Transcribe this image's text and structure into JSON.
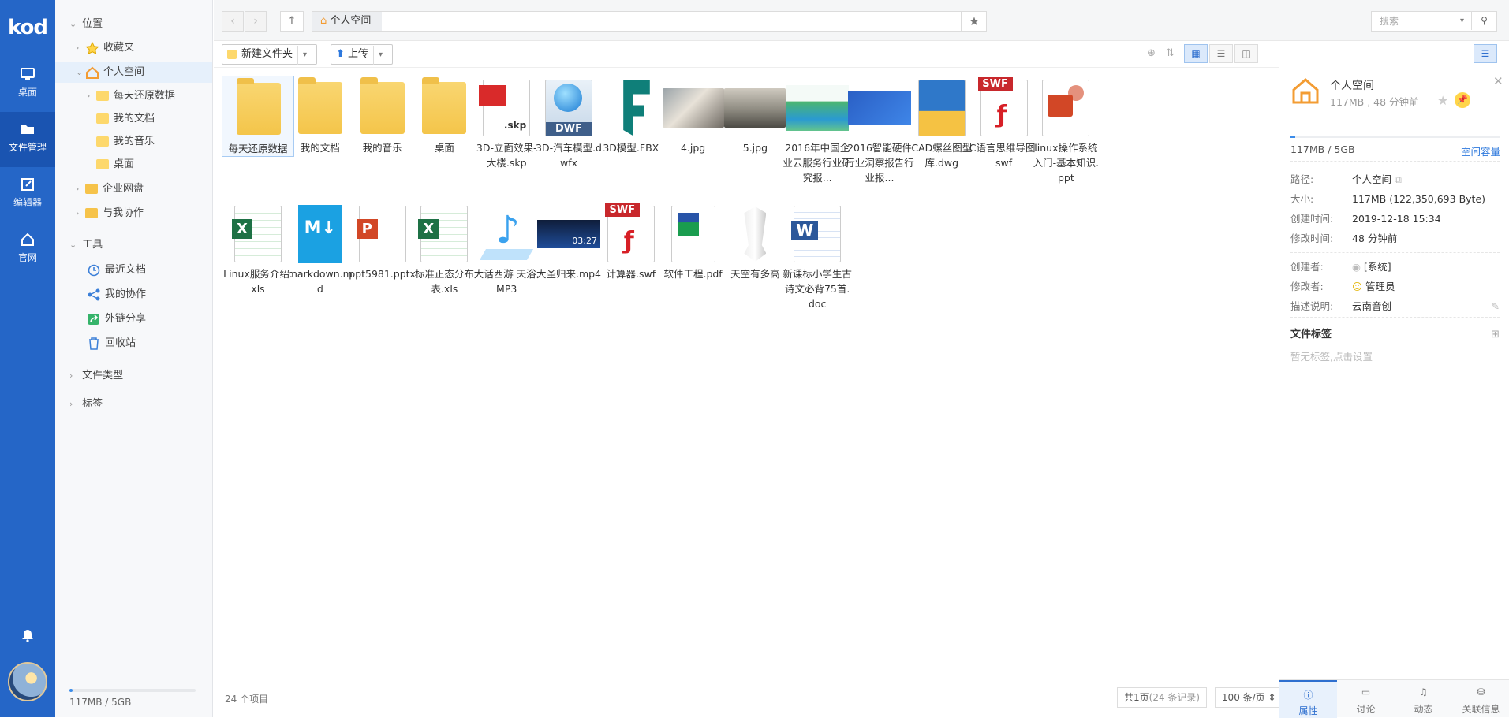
{
  "brand": {
    "logo": "kod",
    "accent": "#2566c7"
  },
  "rail": {
    "items": [
      {
        "label": "桌面",
        "icon": "desktop-icon"
      },
      {
        "label": "文件管理",
        "icon": "folder-icon",
        "active": true
      },
      {
        "label": "编辑器",
        "icon": "edit-icon"
      },
      {
        "label": "官网",
        "icon": "home-icon"
      }
    ]
  },
  "tree": {
    "location": "位置",
    "favorites": "收藏夹",
    "personal": "个人空间",
    "children": [
      "每天还原数据",
      "我的文档",
      "我的音乐",
      "桌面"
    ],
    "enterprise": "企业网盘",
    "coop": "与我协作",
    "tools": "工具",
    "recent": "最近文档",
    "mycoop": "我的协作",
    "share": "外链分享",
    "recycle": "回收站",
    "filetypes": "文件类型",
    "tags": "标签",
    "quota": "117MB / 5GB",
    "quota_fraction": 0.023
  },
  "topbar": {
    "breadcrumb": "个人空间",
    "search_placeholder": "搜索"
  },
  "toolbar": {
    "new_folder": "新建文件夹",
    "upload": "上传"
  },
  "files": [
    {
      "name": "每天还原数据",
      "kind": "folder"
    },
    {
      "name": "我的文档",
      "kind": "folder"
    },
    {
      "name": "我的音乐",
      "kind": "folder"
    },
    {
      "name": "桌面",
      "kind": "folder"
    },
    {
      "name": "3D-立面效果-大楼.skp",
      "kind": "skp",
      "label": ".skp"
    },
    {
      "name": "3D-汽车模型.dwfx",
      "kind": "dwf",
      "label": "DWF"
    },
    {
      "name": "3D模型.FBX",
      "kind": "fbx",
      "label": "F"
    },
    {
      "name": "4.jpg",
      "kind": "img1"
    },
    {
      "name": "5.jpg",
      "kind": "img2"
    },
    {
      "name": "2016年中国企业云服务行业研究报...",
      "kind": "report1"
    },
    {
      "name": "2016智能硬件行业洞察报告行业报...",
      "kind": "report2"
    },
    {
      "name": "CAD螺丝图型库.dwg",
      "kind": "dwg"
    },
    {
      "name": "C语言思维导图.swf",
      "kind": "swf",
      "label": "SWF"
    },
    {
      "name": "linux操作系统入门-基本知识.ppt",
      "kind": "ppt"
    },
    {
      "name": "Linux服务介绍.xls",
      "kind": "xls",
      "label": "X"
    },
    {
      "name": "markdown.md",
      "kind": "md",
      "label": "M↓"
    },
    {
      "name": "ppt5981.pptx",
      "kind": "pptx",
      "label": "P"
    },
    {
      "name": "标准正态分布表.xls",
      "kind": "xls",
      "label": "X"
    },
    {
      "name": "大话西游 天浴.MP3",
      "kind": "mp3",
      "label": "♪"
    },
    {
      "name": "大圣归来.mp4",
      "kind": "mp4",
      "label": "03:27"
    },
    {
      "name": "计算器.swf",
      "kind": "swf",
      "label": "SWF"
    },
    {
      "name": "软件工程.pdf",
      "kind": "pdf"
    },
    {
      "name": "天空有多高",
      "kind": "rocket"
    },
    {
      "name": "新课标小学生古诗文必背75首.doc",
      "kind": "doc",
      "label": "W"
    }
  ],
  "status": {
    "count": "24 个项目",
    "pages": "共1页",
    "records": "(24 条记录)",
    "per_page": "100 条/页"
  },
  "info": {
    "title": "个人空间",
    "subtitle": "117MB , 48 分钟前",
    "quota": "117MB / 5GB",
    "quota_link": "空间容量",
    "quota_fraction": 0.023,
    "rows": [
      {
        "k": "路径:",
        "v": "个人空间"
      },
      {
        "k": "大小:",
        "v": "117MB (122,350,693 Byte)"
      },
      {
        "k": "创建时间:",
        "v": "2019-12-18 15:34"
      },
      {
        "k": "修改时间:",
        "v": "48 分钟前"
      },
      {
        "k": "创建者:",
        "v": "[系统]"
      },
      {
        "k": "修改者:",
        "v": "管理员"
      },
      {
        "k": "描述说明:",
        "v": "云南音创"
      }
    ],
    "tags_title": "文件标签",
    "tags_hint": "暂无标签,点击设置",
    "tabs": [
      "属性",
      "讨论",
      "动态",
      "关联信息"
    ]
  }
}
